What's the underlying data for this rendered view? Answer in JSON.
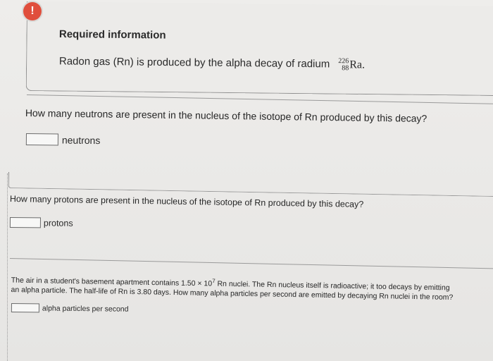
{
  "required_info": {
    "badge": "!",
    "title": "Required information",
    "text": "Radon gas (Rn) is produced by the alpha decay of radium",
    "nuclide_mass": "226",
    "nuclide_atomic": "88",
    "nuclide_symbol": "Ra",
    "nuclide_suffix": "."
  },
  "question1": {
    "text": "How many neutrons are present in the nucleus of the isotope of Rn produced by this decay?",
    "input_value": "",
    "unit": "neutrons"
  },
  "question2": {
    "text": "How many protons are present in the nucleus of the isotope of Rn produced by this decay?",
    "input_value": "",
    "unit": "protons"
  },
  "question3": {
    "text_before_exp": "The air in a student's basement apartment contains 1.50 × 10",
    "exponent": "7",
    "text_line1_rest": " Rn nuclei. The Rn nucleus itself is radioactive; it too decays by emitting",
    "text_line2": "an alpha particle. The half-life of Rn is 3.80 days. How many alpha particles per second are emitted by decaying Rn nuclei in the room?",
    "input_value": "",
    "unit": "alpha particles per second"
  },
  "colors": {
    "badge": "#e04e3c",
    "background": "#ebeae8"
  },
  "icons": {
    "badge": "exclamation-icon"
  }
}
